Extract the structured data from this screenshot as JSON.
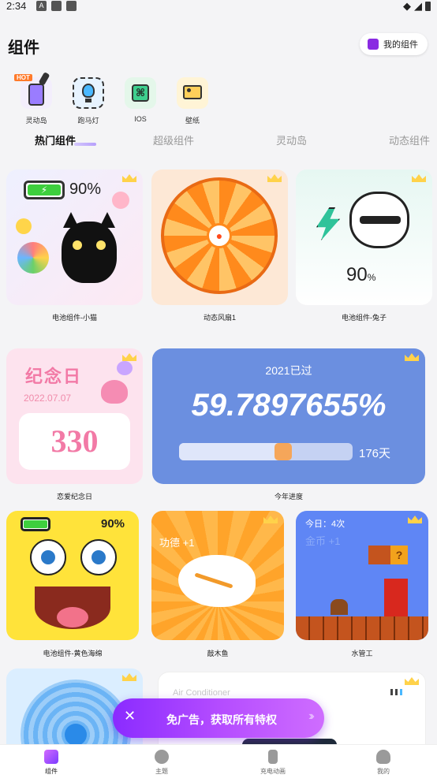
{
  "status": {
    "time": "2:34"
  },
  "header": {
    "title": "组件",
    "my_widgets": "我的组件"
  },
  "categories": [
    {
      "label": "灵动岛",
      "badge": "HOT",
      "icon": "phone-icon"
    },
    {
      "label": "跑马灯",
      "icon": "lightbulb-icon"
    },
    {
      "label": "IOS",
      "icon": "command-icon"
    },
    {
      "label": "壁纸",
      "icon": "image-icon"
    }
  ],
  "tabs": [
    "热门组件",
    "超级组件",
    "灵动岛",
    "动态组件"
  ],
  "widgets": {
    "cat": {
      "caption": "电池组件-小猫",
      "battery": "90%"
    },
    "fan": {
      "caption": "动态风扇1"
    },
    "rabbit": {
      "caption": "电池组件-兔子",
      "battery": "90",
      "unit": "%"
    },
    "anniv": {
      "caption": "恋爱纪念日",
      "title": "纪念日",
      "date": "2022.07.07",
      "days": "330"
    },
    "year": {
      "caption": "今年进度",
      "heading": "2021已过",
      "percent": "59.7897655%",
      "days": "176天",
      "progress": 0.5979
    },
    "sponge": {
      "caption": "电池组件-黄色海绵",
      "battery": "90%"
    },
    "fish": {
      "caption": "敲木鱼",
      "merit": "功德 +1"
    },
    "mario": {
      "caption": "水管工",
      "today": "今日：4次",
      "coins": "金币 +1"
    },
    "fan2": {},
    "aircon": {
      "label": "Air Conditioner"
    }
  },
  "promo": {
    "text": "免广告，获取所有特权"
  },
  "nav": [
    {
      "label": "组件",
      "icon": "widget-icon"
    },
    {
      "label": "主题",
      "icon": "palette-icon"
    },
    {
      "label": "充电动画",
      "icon": "charging-icon"
    },
    {
      "label": "我的",
      "icon": "profile-icon"
    }
  ]
}
